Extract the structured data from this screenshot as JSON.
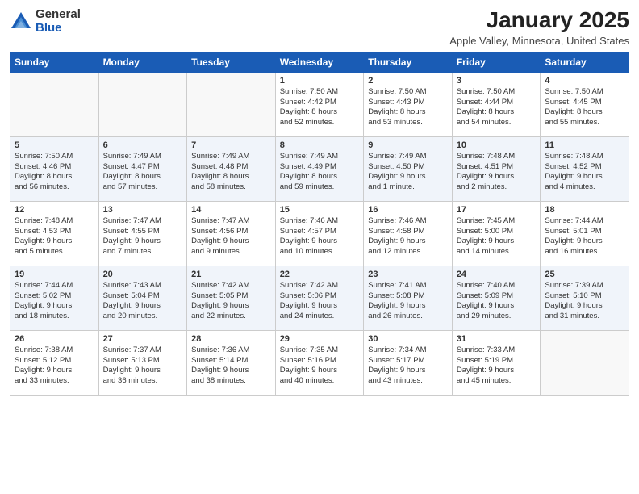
{
  "header": {
    "logo_general": "General",
    "logo_blue": "Blue",
    "month_title": "January 2025",
    "location": "Apple Valley, Minnesota, United States"
  },
  "days_of_week": [
    "Sunday",
    "Monday",
    "Tuesday",
    "Wednesday",
    "Thursday",
    "Friday",
    "Saturday"
  ],
  "weeks": [
    [
      {
        "day": "",
        "info": ""
      },
      {
        "day": "",
        "info": ""
      },
      {
        "day": "",
        "info": ""
      },
      {
        "day": "1",
        "info": "Sunrise: 7:50 AM\nSunset: 4:42 PM\nDaylight: 8 hours\nand 52 minutes."
      },
      {
        "day": "2",
        "info": "Sunrise: 7:50 AM\nSunset: 4:43 PM\nDaylight: 8 hours\nand 53 minutes."
      },
      {
        "day": "3",
        "info": "Sunrise: 7:50 AM\nSunset: 4:44 PM\nDaylight: 8 hours\nand 54 minutes."
      },
      {
        "day": "4",
        "info": "Sunrise: 7:50 AM\nSunset: 4:45 PM\nDaylight: 8 hours\nand 55 minutes."
      }
    ],
    [
      {
        "day": "5",
        "info": "Sunrise: 7:50 AM\nSunset: 4:46 PM\nDaylight: 8 hours\nand 56 minutes."
      },
      {
        "day": "6",
        "info": "Sunrise: 7:49 AM\nSunset: 4:47 PM\nDaylight: 8 hours\nand 57 minutes."
      },
      {
        "day": "7",
        "info": "Sunrise: 7:49 AM\nSunset: 4:48 PM\nDaylight: 8 hours\nand 58 minutes."
      },
      {
        "day": "8",
        "info": "Sunrise: 7:49 AM\nSunset: 4:49 PM\nDaylight: 8 hours\nand 59 minutes."
      },
      {
        "day": "9",
        "info": "Sunrise: 7:49 AM\nSunset: 4:50 PM\nDaylight: 9 hours\nand 1 minute."
      },
      {
        "day": "10",
        "info": "Sunrise: 7:48 AM\nSunset: 4:51 PM\nDaylight: 9 hours\nand 2 minutes."
      },
      {
        "day": "11",
        "info": "Sunrise: 7:48 AM\nSunset: 4:52 PM\nDaylight: 9 hours\nand 4 minutes."
      }
    ],
    [
      {
        "day": "12",
        "info": "Sunrise: 7:48 AM\nSunset: 4:53 PM\nDaylight: 9 hours\nand 5 minutes."
      },
      {
        "day": "13",
        "info": "Sunrise: 7:47 AM\nSunset: 4:55 PM\nDaylight: 9 hours\nand 7 minutes."
      },
      {
        "day": "14",
        "info": "Sunrise: 7:47 AM\nSunset: 4:56 PM\nDaylight: 9 hours\nand 9 minutes."
      },
      {
        "day": "15",
        "info": "Sunrise: 7:46 AM\nSunset: 4:57 PM\nDaylight: 9 hours\nand 10 minutes."
      },
      {
        "day": "16",
        "info": "Sunrise: 7:46 AM\nSunset: 4:58 PM\nDaylight: 9 hours\nand 12 minutes."
      },
      {
        "day": "17",
        "info": "Sunrise: 7:45 AM\nSunset: 5:00 PM\nDaylight: 9 hours\nand 14 minutes."
      },
      {
        "day": "18",
        "info": "Sunrise: 7:44 AM\nSunset: 5:01 PM\nDaylight: 9 hours\nand 16 minutes."
      }
    ],
    [
      {
        "day": "19",
        "info": "Sunrise: 7:44 AM\nSunset: 5:02 PM\nDaylight: 9 hours\nand 18 minutes."
      },
      {
        "day": "20",
        "info": "Sunrise: 7:43 AM\nSunset: 5:04 PM\nDaylight: 9 hours\nand 20 minutes."
      },
      {
        "day": "21",
        "info": "Sunrise: 7:42 AM\nSunset: 5:05 PM\nDaylight: 9 hours\nand 22 minutes."
      },
      {
        "day": "22",
        "info": "Sunrise: 7:42 AM\nSunset: 5:06 PM\nDaylight: 9 hours\nand 24 minutes."
      },
      {
        "day": "23",
        "info": "Sunrise: 7:41 AM\nSunset: 5:08 PM\nDaylight: 9 hours\nand 26 minutes."
      },
      {
        "day": "24",
        "info": "Sunrise: 7:40 AM\nSunset: 5:09 PM\nDaylight: 9 hours\nand 29 minutes."
      },
      {
        "day": "25",
        "info": "Sunrise: 7:39 AM\nSunset: 5:10 PM\nDaylight: 9 hours\nand 31 minutes."
      }
    ],
    [
      {
        "day": "26",
        "info": "Sunrise: 7:38 AM\nSunset: 5:12 PM\nDaylight: 9 hours\nand 33 minutes."
      },
      {
        "day": "27",
        "info": "Sunrise: 7:37 AM\nSunset: 5:13 PM\nDaylight: 9 hours\nand 36 minutes."
      },
      {
        "day": "28",
        "info": "Sunrise: 7:36 AM\nSunset: 5:14 PM\nDaylight: 9 hours\nand 38 minutes."
      },
      {
        "day": "29",
        "info": "Sunrise: 7:35 AM\nSunset: 5:16 PM\nDaylight: 9 hours\nand 40 minutes."
      },
      {
        "day": "30",
        "info": "Sunrise: 7:34 AM\nSunset: 5:17 PM\nDaylight: 9 hours\nand 43 minutes."
      },
      {
        "day": "31",
        "info": "Sunrise: 7:33 AM\nSunset: 5:19 PM\nDaylight: 9 hours\nand 45 minutes."
      },
      {
        "day": "",
        "info": ""
      }
    ]
  ]
}
